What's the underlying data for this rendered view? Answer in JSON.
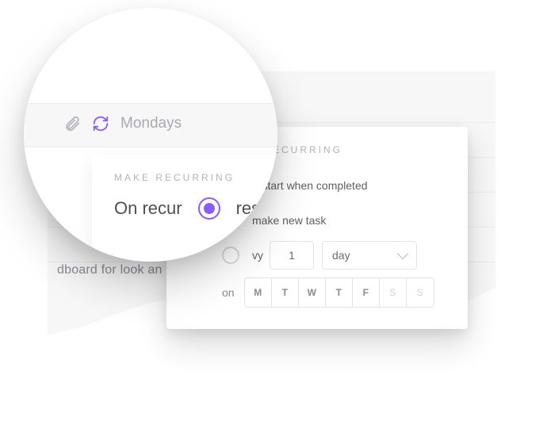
{
  "colors": {
    "accent": "#8b5cf6"
  },
  "background_task_fragment": "dboard for look an",
  "recurrence_label": "Mondays",
  "popover": {
    "title": "MAKE RECURRING",
    "on_recur_label": "On recur",
    "options": {
      "restart_label": "restart when completed",
      "restart_short": "resta",
      "new_task_label": "make new task",
      "every_label": "vy",
      "selected": "restart"
    },
    "interval": {
      "count": "1",
      "unit": "day"
    },
    "on_label": "on",
    "days": [
      {
        "abbr": "M",
        "active": true
      },
      {
        "abbr": "T",
        "active": true
      },
      {
        "abbr": "W",
        "active": true
      },
      {
        "abbr": "T",
        "active": true
      },
      {
        "abbr": "F",
        "active": true
      },
      {
        "abbr": "S",
        "active": false
      },
      {
        "abbr": "S",
        "active": false
      }
    ]
  }
}
